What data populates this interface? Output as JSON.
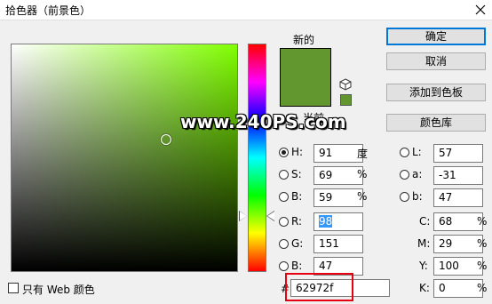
{
  "window": {
    "title": "拾色器（前景色）"
  },
  "picker": {
    "hue_color": "#80ff00",
    "new_color": "#62972f",
    "current_color": "#62972f"
  },
  "labels": {
    "new": "新的",
    "current": "当前"
  },
  "buttons": {
    "ok": "确定",
    "cancel": "取消",
    "add_to_swatches": "添加到色板",
    "color_libraries": "颜色库"
  },
  "fields": {
    "H": {
      "label": "H:",
      "value": "91",
      "unit": "度"
    },
    "S": {
      "label": "S:",
      "value": "69",
      "unit": "%"
    },
    "B": {
      "label": "B:",
      "value": "59",
      "unit": "%"
    },
    "R": {
      "label": "R:",
      "value": "98"
    },
    "G": {
      "label": "G:",
      "value": "151"
    },
    "Bl": {
      "label": "B:",
      "value": "47"
    },
    "L": {
      "label": "L:",
      "value": "57"
    },
    "a": {
      "label": "a:",
      "value": "-31"
    },
    "b": {
      "label": "b:",
      "value": "47"
    },
    "C": {
      "label": "C:",
      "value": "68",
      "unit": "%"
    },
    "M": {
      "label": "M:",
      "value": "29",
      "unit": "%"
    },
    "Y": {
      "label": "Y:",
      "value": "100",
      "unit": "%"
    },
    "K": {
      "label": "K:",
      "value": "0",
      "unit": "%"
    }
  },
  "hex": {
    "label": "#",
    "value": "62972f"
  },
  "web_only": {
    "label": "只有 Web 颜色",
    "checked": false
  },
  "watermark": "www.240PS.com"
}
